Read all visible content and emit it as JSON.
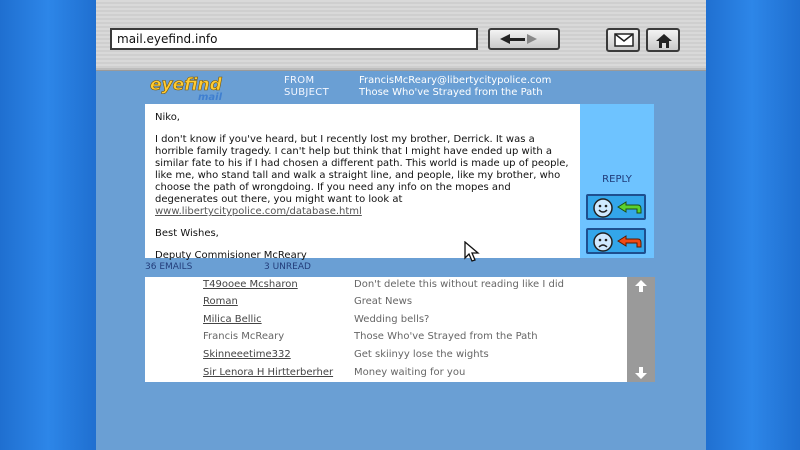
{
  "url_bar": {
    "value": "mail.eyefind.info"
  },
  "logo": {
    "main": "eyefind",
    "sub": "mail"
  },
  "header": {
    "from_label": "FROM",
    "subject_label": "SUBJECT",
    "from_value": "FrancisMcReary@libertycitypolice.com",
    "subject_value": "Those Who've Strayed from the Path"
  },
  "message": {
    "greeting": "Niko,",
    "body": "I don't know if you've heard, but I recently lost my brother, Derrick. It was a horrible family tragedy. I can't help but think that I might have ended up with a similar fate to his if I had chosen a different path. This world is made up of people, like me, who stand tall and walk a straight line, and people, like my brother, who choose the path of wrongdoing. If you need any info on the mopes and degenerates out there, you might want to look at",
    "link": "www.libertycitypolice.com/database.html",
    "closing": "Best Wishes,",
    "signature": "Deputy Commisioner McReary"
  },
  "side_panel": {
    "reply_label": "REPLY"
  },
  "counts": {
    "emails": "36 EMAILS",
    "unread": "3 UNREAD"
  },
  "emails": [
    {
      "sender": "T49ooee Mcsharon",
      "subject": "Don't delete this without reading like I did",
      "unread": true
    },
    {
      "sender": "Roman",
      "subject": "Great News",
      "unread": true
    },
    {
      "sender": "Milica Bellic",
      "subject": "Wedding bells?",
      "unread": true
    },
    {
      "sender": "Francis McReary",
      "subject": "Those Who've Strayed from the Path",
      "unread": false
    },
    {
      "sender": "Skinneeetime332",
      "subject": "Get skiinyy lose the wights",
      "unread": true
    },
    {
      "sender": "Sir Lenora H Hirtterberher",
      "subject": "Money waiting for you",
      "unread": true
    }
  ],
  "colors": {
    "background": "#1f6fd0",
    "window": "#6a9fd4",
    "side_panel": "#6ec3ff",
    "scrollbar": "#9a9a9a"
  }
}
